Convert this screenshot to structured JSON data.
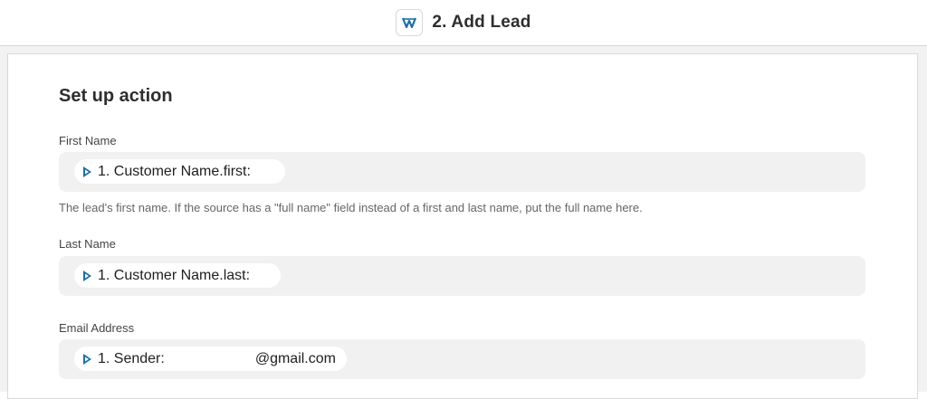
{
  "header": {
    "app_icon": "app-logo-icon",
    "step_title": "2. Add Lead"
  },
  "section": {
    "title": "Set up action"
  },
  "fields": [
    {
      "label": "First Name",
      "token_icon": "source-app-icon",
      "value": "1. Customer Name.first:",
      "help": "The lead's first name. If the source has a \"full name\" field instead of a first and last name, put the full name here."
    },
    {
      "label": "Last Name",
      "token_icon": "source-app-icon",
      "value": "1. Customer Name.last:"
    },
    {
      "label": "Email Address",
      "token_icon": "source-app-icon",
      "value": "1. Sender:",
      "value_suffix": "@gmail.com"
    }
  ],
  "colors": {
    "accent_icon": "#1b6fa8",
    "field_bg": "#f1f1f1",
    "text": "#2d2e2e"
  }
}
